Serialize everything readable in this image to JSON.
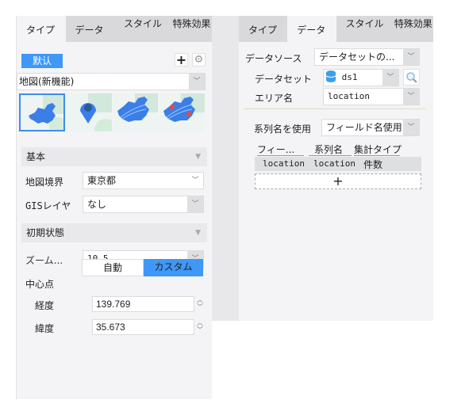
{
  "left_panel": {
    "tabs": [
      {
        "label": "タイプ",
        "active": true
      },
      {
        "label": "データ",
        "active": false
      },
      {
        "label": "スタイル",
        "active": false
      },
      {
        "label": "特殊効果",
        "active": false
      }
    ],
    "default_button": "默认",
    "add_icon": "plus-icon",
    "settings_icon": "gear-icon",
    "chart_type_select": "地図(新機能)",
    "map_thumbnails": [
      {
        "name": "region-map",
        "selected": true
      },
      {
        "name": "point-map",
        "selected": false
      },
      {
        "name": "flow-map",
        "selected": false
      },
      {
        "name": "flow-point-map",
        "selected": false
      }
    ],
    "basic_section": "基本",
    "map_boundary_label": "地図境界",
    "map_boundary_value": "東京都",
    "gis_layer_label": "GISレイヤ",
    "gis_layer_value": "なし",
    "initial_state_section": "初期状態",
    "zoom_label": "ズーム...",
    "zoom_value": "10.5",
    "center_label": "中心点",
    "center_options": [
      "自動",
      "カスタム"
    ],
    "center_selected": "カスタム",
    "longitude_label": "経度",
    "longitude_value": "139.769",
    "latitude_label": "緯度",
    "latitude_value": "35.673"
  },
  "right_panel": {
    "tabs": [
      {
        "label": "タイプ",
        "active": false
      },
      {
        "label": "データ",
        "active": true
      },
      {
        "label": "スタイル",
        "active": false
      },
      {
        "label": "特殊効果",
        "active": false
      }
    ],
    "data_source_label": "データソース",
    "data_source_value": "データセットの...",
    "dataset_label": "データセット",
    "dataset_value": "ds1",
    "dataset_icon": "database-icon",
    "search_icon": "search-icon",
    "area_name_label": "エリア名",
    "area_name_value": "location",
    "series_name_label": "系列名を使用",
    "series_name_value": "フィールド名使用",
    "table": {
      "headers": [
        "フィー...",
        "系列名",
        "集計タイプ"
      ],
      "rows": [
        [
          "location",
          "location",
          "件数"
        ]
      ]
    },
    "add_row_label": "+"
  },
  "colors": {
    "accent": "#3f97f8",
    "panel_bg": "#f4f4f6",
    "tab_inactive_bg": "#d9d9db",
    "map_blue": "#3b7ee8",
    "marker_red": "#e84a3b"
  }
}
